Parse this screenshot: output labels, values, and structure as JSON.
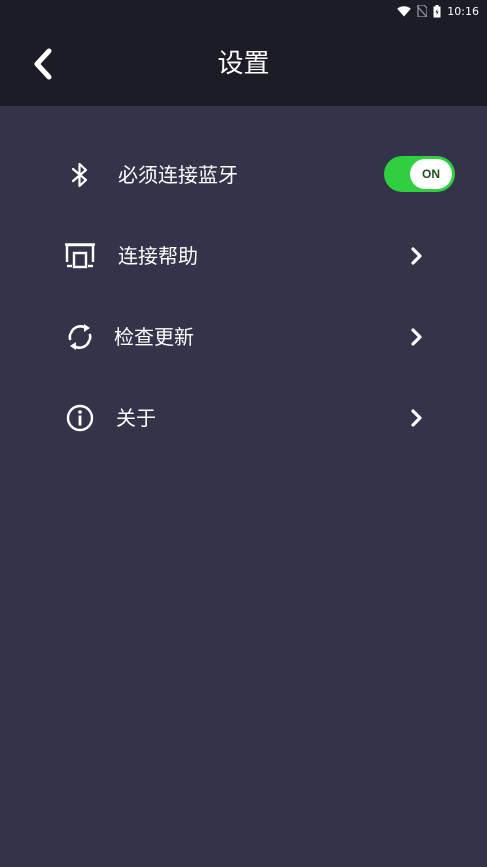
{
  "status_bar": {
    "time": "10:16"
  },
  "header": {
    "title": "设置"
  },
  "settings": {
    "bluetooth": {
      "label": "必须连接蓝牙",
      "toggle": "ON"
    },
    "help": {
      "label": "连接帮助"
    },
    "update": {
      "label": "检查更新"
    },
    "about": {
      "label": "关于"
    }
  },
  "colors": {
    "background": "#33344a",
    "header": "#1c1c26",
    "toggle_on": "#2fcf3f"
  }
}
